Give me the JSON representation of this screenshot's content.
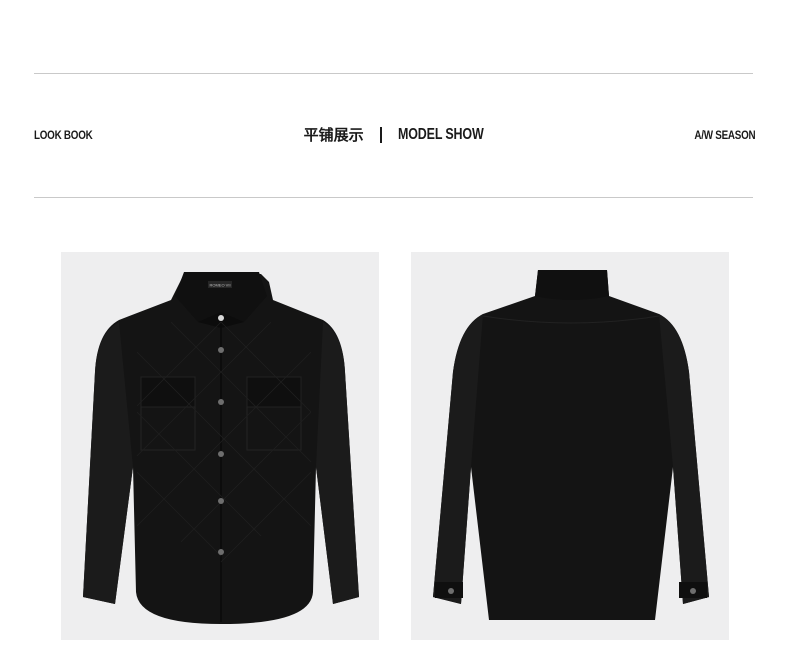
{
  "header": {
    "left_label": "LOOK BOOK",
    "center_cn": "平铺展示",
    "center_en": "MODEL SHOW",
    "right_label": "A/W SEASON"
  },
  "photos": {
    "front": {
      "icon": "jacket-front-image",
      "tag_text": "ROMEO VII"
    },
    "back": {
      "icon": "jacket-back-image"
    }
  },
  "colors": {
    "background": "#ffffff",
    "photo_bg": "#eeeeef",
    "garment": "#141414",
    "rule": "#c9c9c9"
  }
}
